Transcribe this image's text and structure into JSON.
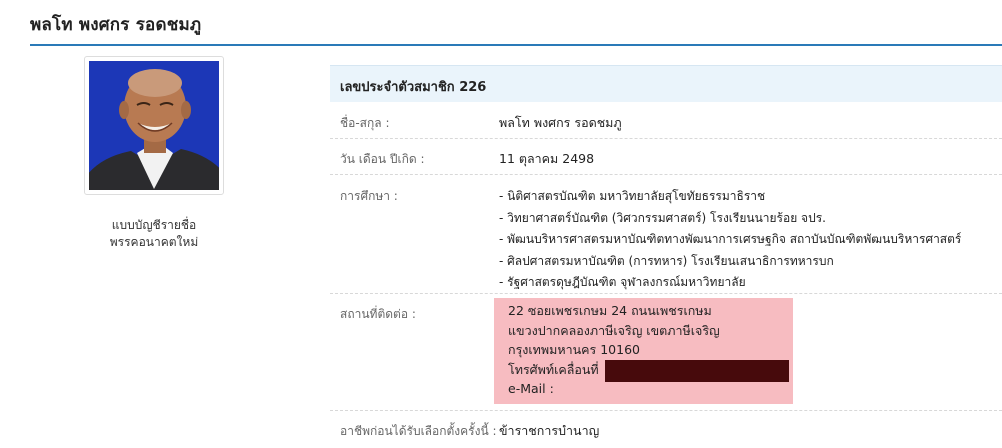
{
  "profile": {
    "name": "พลโท พงศกร  รอดชมภู"
  },
  "sidebar": {
    "list_type": "แบบบัญชีรายชื่อ",
    "party": "พรรคอนาคตใหม่"
  },
  "info": {
    "member_id_heading": "เลขประจำตัวสมาชิก 226",
    "name_label": "ชื่อ-สกุล :",
    "name_value": "พลโท พงศกร  รอดชมภู",
    "dob_label": "วัน เดือน ปีเกิด :",
    "dob_value": "11 ตุลาคม 2498",
    "education_label": "การศึกษา :",
    "education": [
      "- นิติศาสตรบัณฑิต มหาวิทยาลัยสุโขทัยธรรมาธิราช",
      "- วิทยาศาสตร์บัณฑิต (วิศวกรรมศาสตร์) โรงเรียนนายร้อย จปร.",
      "- พัฒนบริหารศาสตรมหาบัณฑิตทางพัฒนาการเศรษฐกิจ สถาบันบัณฑิตพัฒนบริหารศาสตร์",
      "- ศิลปศาสตรมหาบัณฑิต (การทหาร) โรงเรียนเสนาธิการทหารบก",
      "- รัฐศาสตรดุษฎีบัณฑิต จุฬาลงกรณ์มหาวิทยาลัย"
    ],
    "contact_label": "สถานที่ติดต่อ :",
    "contact": {
      "address1": "22 ซอยเพชรเกษม 24 ถนนเพชรเกษม",
      "address2": "แขวงปากคลองภาษีเจริญ เขตภาษีเจริญ",
      "address3": "กรุงเทพมหานคร 10160",
      "mobile_label": "โทรศัพท์เคลื่อนที่",
      "email_label": "e-Mail :"
    },
    "occupation_label": "อาชีพก่อนได้รับเลือกตั้งครั้งนี้ :",
    "occupation_value": "ข้าราชการบำนาญ"
  },
  "colors": {
    "accent_rule": "#2a7ab8",
    "header_bg": "#eaf4fb",
    "contact_bg": "#f7bcc1",
    "redaction": "#470a0c",
    "photo_bg": "#1c37b7"
  }
}
